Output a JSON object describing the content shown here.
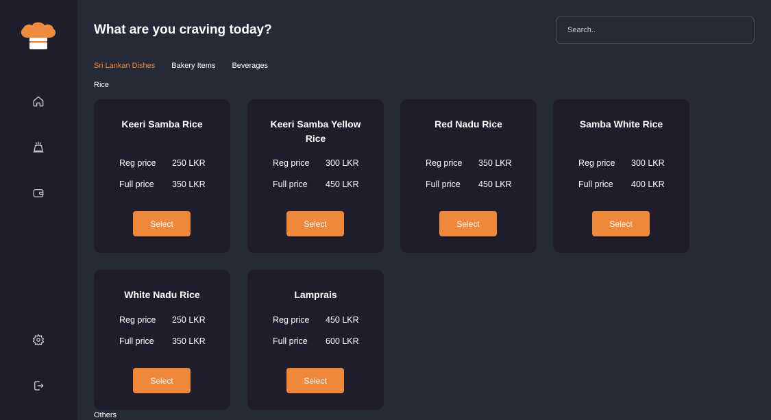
{
  "header": {
    "title": "What are you craving today?",
    "search_placeholder": "Search.."
  },
  "sidebar": {
    "items": [
      {
        "name": "home",
        "icon": "home-icon"
      },
      {
        "name": "dishes",
        "icon": "chef-hat-icon"
      },
      {
        "name": "wallet",
        "icon": "wallet-icon"
      },
      {
        "name": "settings",
        "icon": "gear-icon"
      },
      {
        "name": "logout",
        "icon": "logout-icon"
      }
    ]
  },
  "tabs": [
    {
      "label": "Sri Lankan Dishes",
      "active": true
    },
    {
      "label": "Bakery Items",
      "active": false
    },
    {
      "label": "Beverages",
      "active": false
    }
  ],
  "sections": {
    "rice": "Rice",
    "others": "Others"
  },
  "price_labels": {
    "reg": "Reg price",
    "full": "Full price"
  },
  "select_label": "Select",
  "items": [
    {
      "name": "Keeri Samba Rice",
      "reg": "250 LKR",
      "full": "350 LKR"
    },
    {
      "name": "Keeri Samba Yellow Rice",
      "reg": "300 LKR",
      "full": "450 LKR"
    },
    {
      "name": "Red Nadu Rice",
      "reg": "350 LKR",
      "full": "450 LKR"
    },
    {
      "name": "Samba White Rice",
      "reg": "300 LKR",
      "full": "400 LKR"
    },
    {
      "name": "White Nadu Rice",
      "reg": "250 LKR",
      "full": "350 LKR"
    },
    {
      "name": "Lamprais",
      "reg": "450 LKR",
      "full": "600 LKR"
    }
  ],
  "colors": {
    "accent": "#f0883a",
    "background": "#262a36",
    "sidebar": "#1f1d2b",
    "card": "#1f1d2b"
  }
}
